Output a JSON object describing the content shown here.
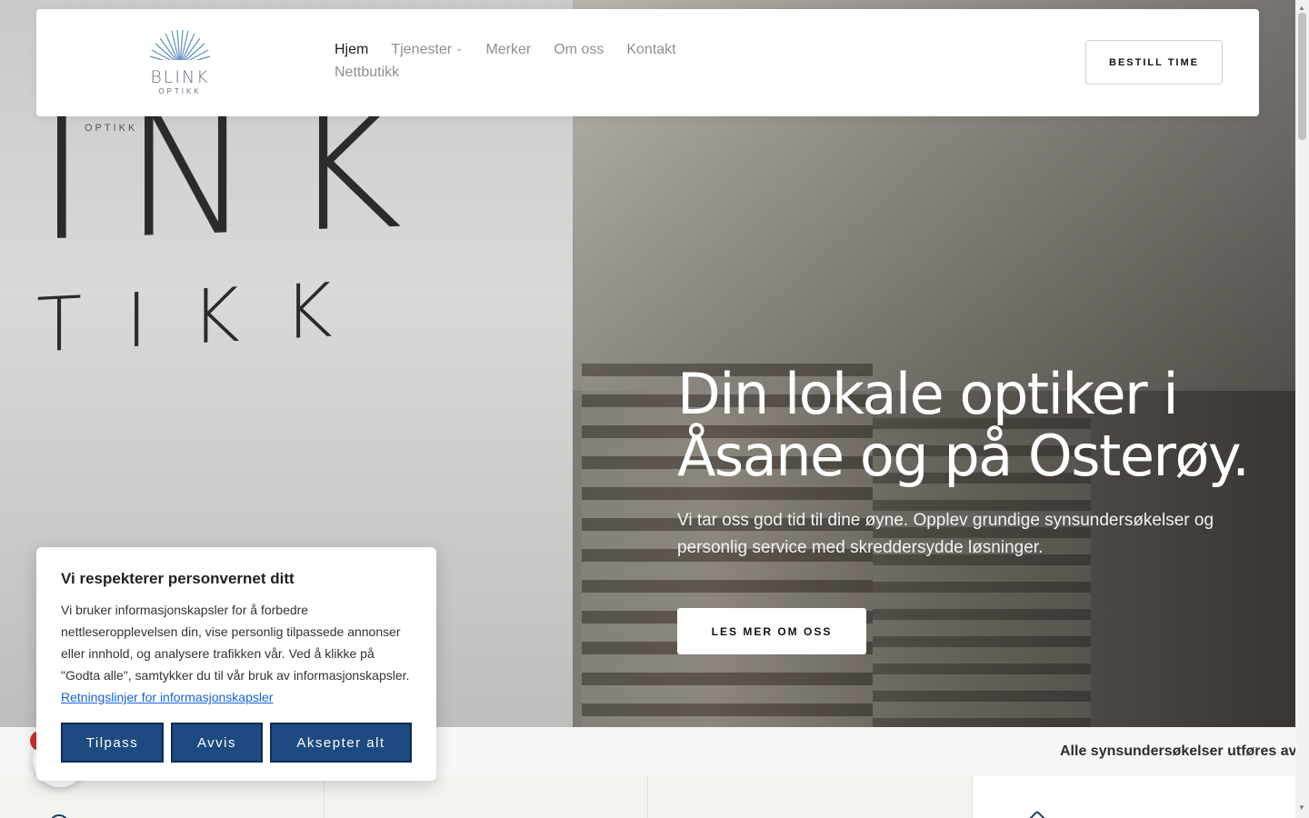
{
  "brand": {
    "name": "BLINK",
    "sub": "OPTIKK"
  },
  "nav": {
    "items": [
      {
        "label": "Hjem",
        "active": true,
        "dropdown": false
      },
      {
        "label": "Tjenester",
        "active": false,
        "dropdown": true
      },
      {
        "label": "Merker",
        "active": false,
        "dropdown": false
      },
      {
        "label": "Om oss",
        "active": false,
        "dropdown": false
      },
      {
        "label": "Kontakt",
        "active": false,
        "dropdown": false
      },
      {
        "label": "Nettbutikk",
        "active": false,
        "dropdown": false
      }
    ],
    "cta": "BESTILL TIME"
  },
  "hero": {
    "wall_big": "INK",
    "wall_small": "TIKK",
    "wall_sub": "OPTIKK",
    "title_line1": "Din lokale optiker i",
    "title_line2": "Åsane og på Osterøy.",
    "text": "Vi tar oss god tid til dine øyne. Opplev grundige synsundersøkelser og personlig service med skreddersydde løsninger.",
    "button": "LES MER OM OSS"
  },
  "ticker": {
    "text": "Alle synsundersøkelser utføres av au"
  },
  "cookie": {
    "title": "Vi respekterer personvernet ditt",
    "text": "Vi bruker informasjonskapsler for å forbedre nettleseropplevelsen din, vise personlig tilpassede annonser eller innhold, og analysere trafikken vår. Ved å klikke på \"Godta alle\", samtykker du til vår bruk av informasjonskapsler.",
    "link": "Retningslinjer for informasjonskapsler",
    "buttons": {
      "customize": "Tilpass",
      "reject": "Avvis",
      "accept": "Aksepter alt"
    },
    "button_color": "#1d4a80"
  },
  "icons": {
    "chevron": "chevron-down-icon",
    "logo": "sunburst-logo-icon"
  }
}
